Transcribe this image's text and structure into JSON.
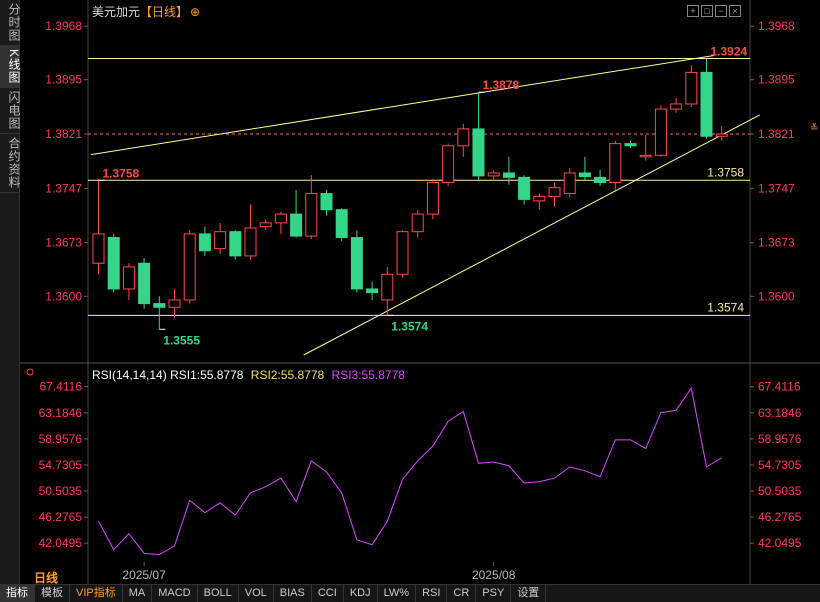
{
  "side_tabs": [
    {
      "label": "分时图",
      "active": false
    },
    {
      "label": "K线图",
      "active": true
    },
    {
      "label": "闪电图",
      "active": false
    },
    {
      "label": "合约资料",
      "active": false
    }
  ],
  "header": {
    "symbol": "美元加元",
    "period": "【日线】",
    "target_icon": "⊕"
  },
  "tool_icons": [
    "crosshair-icon",
    "zoom-in-icon",
    "zoom-out-icon",
    "close-icon"
  ],
  "colors": {
    "up": "#ff4a4a",
    "down": "#36d68a",
    "hline": "#fff0a0",
    "trend": "#ffff9a",
    "rsi": "#d94cff",
    "axis_text": "#ff3b5f",
    "price_up_axis": "#ff3b5f"
  },
  "chart_data": [
    {
      "type": "candlestick",
      "y_ticks": [
        "1.3968",
        "1.3895",
        "1.3821",
        "1.3747",
        "1.3673",
        "1.3600"
      ],
      "ylim": [
        1.352,
        1.399
      ],
      "x_labels": [
        {
          "text": "2025/07",
          "index": 3
        },
        {
          "text": "2025/08",
          "index": 26
        }
      ],
      "current_price": "1.3821",
      "candles": [
        {
          "o": 1.3645,
          "h": 1.376,
          "l": 1.363,
          "c": 1.3685
        },
        {
          "o": 1.368,
          "h": 1.3685,
          "l": 1.3605,
          "c": 1.361
        },
        {
          "o": 1.361,
          "h": 1.3645,
          "l": 1.3595,
          "c": 1.364
        },
        {
          "o": 1.3645,
          "h": 1.3652,
          "l": 1.3583,
          "c": 1.359
        },
        {
          "o": 1.359,
          "h": 1.36,
          "l": 1.3555,
          "c": 1.3585
        },
        {
          "o": 1.3585,
          "h": 1.361,
          "l": 1.357,
          "c": 1.3595
        },
        {
          "o": 1.3595,
          "h": 1.369,
          "l": 1.359,
          "c": 1.3685
        },
        {
          "o": 1.3685,
          "h": 1.3695,
          "l": 1.3655,
          "c": 1.3662
        },
        {
          "o": 1.3665,
          "h": 1.37,
          "l": 1.3658,
          "c": 1.3688
        },
        {
          "o": 1.3688,
          "h": 1.369,
          "l": 1.365,
          "c": 1.3655
        },
        {
          "o": 1.3655,
          "h": 1.3725,
          "l": 1.365,
          "c": 1.3693
        },
        {
          "o": 1.3695,
          "h": 1.3705,
          "l": 1.369,
          "c": 1.37
        },
        {
          "o": 1.37,
          "h": 1.3715,
          "l": 1.3685,
          "c": 1.3712
        },
        {
          "o": 1.3712,
          "h": 1.3745,
          "l": 1.368,
          "c": 1.3682
        },
        {
          "o": 1.3682,
          "h": 1.3765,
          "l": 1.3678,
          "c": 1.374
        },
        {
          "o": 1.374,
          "h": 1.3745,
          "l": 1.371,
          "c": 1.3718
        },
        {
          "o": 1.3718,
          "h": 1.372,
          "l": 1.3675,
          "c": 1.368
        },
        {
          "o": 1.368,
          "h": 1.369,
          "l": 1.3605,
          "c": 1.361
        },
        {
          "o": 1.361,
          "h": 1.362,
          "l": 1.3595,
          "c": 1.3605
        },
        {
          "o": 1.3595,
          "h": 1.364,
          "l": 1.3574,
          "c": 1.363
        },
        {
          "o": 1.363,
          "h": 1.369,
          "l": 1.3625,
          "c": 1.3688
        },
        {
          "o": 1.3688,
          "h": 1.3718,
          "l": 1.368,
          "c": 1.3712
        },
        {
          "o": 1.3712,
          "h": 1.376,
          "l": 1.3705,
          "c": 1.3755
        },
        {
          "o": 1.3755,
          "h": 1.3808,
          "l": 1.375,
          "c": 1.3805
        },
        {
          "o": 1.3805,
          "h": 1.3835,
          "l": 1.379,
          "c": 1.3828
        },
        {
          "o": 1.3828,
          "h": 1.3878,
          "l": 1.3758,
          "c": 1.3764
        },
        {
          "o": 1.3764,
          "h": 1.3772,
          "l": 1.3758,
          "c": 1.3768
        },
        {
          "o": 1.3768,
          "h": 1.379,
          "l": 1.3752,
          "c": 1.3762
        },
        {
          "o": 1.3762,
          "h": 1.3765,
          "l": 1.3725,
          "c": 1.3732
        },
        {
          "o": 1.373,
          "h": 1.374,
          "l": 1.3718,
          "c": 1.3736
        },
        {
          "o": 1.3736,
          "h": 1.3755,
          "l": 1.3722,
          "c": 1.3748
        },
        {
          "o": 1.374,
          "h": 1.3775,
          "l": 1.3735,
          "c": 1.3768
        },
        {
          "o": 1.3768,
          "h": 1.379,
          "l": 1.3758,
          "c": 1.3763
        },
        {
          "o": 1.3762,
          "h": 1.3772,
          "l": 1.375,
          "c": 1.3755
        },
        {
          "o": 1.3755,
          "h": 1.3812,
          "l": 1.3745,
          "c": 1.3808
        },
        {
          "o": 1.3808,
          "h": 1.3812,
          "l": 1.3802,
          "c": 1.3805
        },
        {
          "o": 1.379,
          "h": 1.382,
          "l": 1.3785,
          "c": 1.3792
        },
        {
          "o": 1.3792,
          "h": 1.386,
          "l": 1.379,
          "c": 1.3855
        },
        {
          "o": 1.3855,
          "h": 1.387,
          "l": 1.385,
          "c": 1.3862
        },
        {
          "o": 1.3862,
          "h": 1.3915,
          "l": 1.3858,
          "c": 1.3905
        },
        {
          "o": 1.3905,
          "h": 1.3924,
          "l": 1.3815,
          "c": 1.3818
        },
        {
          "o": 1.3818,
          "h": 1.3832,
          "l": 1.3812,
          "c": 1.3821
        }
      ],
      "h_lines": [
        {
          "price": 1.3924,
          "label": "1.3924"
        },
        {
          "price": 1.3758,
          "label": "1.3758"
        },
        {
          "price": 1.3574,
          "label": "1.3574"
        }
      ],
      "annotations": [
        {
          "index": 0,
          "price": 1.3758,
          "text": "1.3758",
          "color": "#ff4a4a"
        },
        {
          "index": 4,
          "price": 1.3555,
          "text": "1.3555",
          "color": "#36d68a"
        },
        {
          "index": 19,
          "price": 1.3574,
          "text": "1.3574",
          "color": "#36d68a"
        },
        {
          "index": 25,
          "price": 1.3878,
          "text": "1.3878",
          "color": "#ff4a4a"
        },
        {
          "index": 40,
          "price": 1.3924,
          "text": "1.3924",
          "color": "#ff4a4a"
        }
      ],
      "trend_lines": [
        {
          "from": [
            -0.5,
            1.3793
          ],
          "to": [
            40.5,
            1.3928
          ]
        },
        {
          "from": [
            13.5,
            1.352
          ],
          "to": [
            43.5,
            1.3847
          ]
        }
      ]
    },
    {
      "type": "line",
      "name": "RSI",
      "header": {
        "main": "RSI(14,14,14)",
        "rsi1": "RSI1:55.8778",
        "rsi2": "RSI2:55.8778",
        "rsi3": "RSI3:55.8778"
      },
      "y_ticks": [
        "67.4116",
        "63.1846",
        "58.9576",
        "54.7305",
        "50.5035",
        "46.2765",
        "42.0495"
      ],
      "ylim": [
        39.0,
        68.5
      ],
      "values": [
        45.6,
        41.0,
        43.6,
        40.4,
        40.2,
        41.6,
        49.0,
        47.0,
        48.6,
        46.6,
        50.2,
        51.2,
        52.6,
        48.8,
        55.4,
        53.6,
        50.2,
        42.6,
        41.8,
        45.6,
        52.4,
        55.4,
        57.8,
        61.8,
        63.4,
        55.0,
        55.2,
        54.6,
        51.8,
        52.0,
        52.6,
        54.4,
        53.8,
        52.8,
        58.8,
        58.8,
        57.4,
        63.2,
        63.6,
        67.2,
        54.4,
        55.9
      ]
    }
  ],
  "period_label": "日线",
  "bottom_tabs": [
    {
      "label": "指标",
      "active": true
    },
    {
      "label": "模板",
      "active": false
    },
    {
      "label": "VIP指标",
      "active": false,
      "vip": true
    },
    {
      "label": "MA",
      "active": false
    },
    {
      "label": "MACD",
      "active": false
    },
    {
      "label": "BOLL",
      "active": false
    },
    {
      "label": "VOL",
      "active": false
    },
    {
      "label": "BIAS",
      "active": false
    },
    {
      "label": "CCI",
      "active": false
    },
    {
      "label": "KDJ",
      "active": false
    },
    {
      "label": "LW%",
      "active": false
    },
    {
      "label": "RSI",
      "active": false
    },
    {
      "label": "CR",
      "active": false
    },
    {
      "label": "PSY",
      "active": false
    },
    {
      "label": "设置",
      "active": false
    }
  ]
}
